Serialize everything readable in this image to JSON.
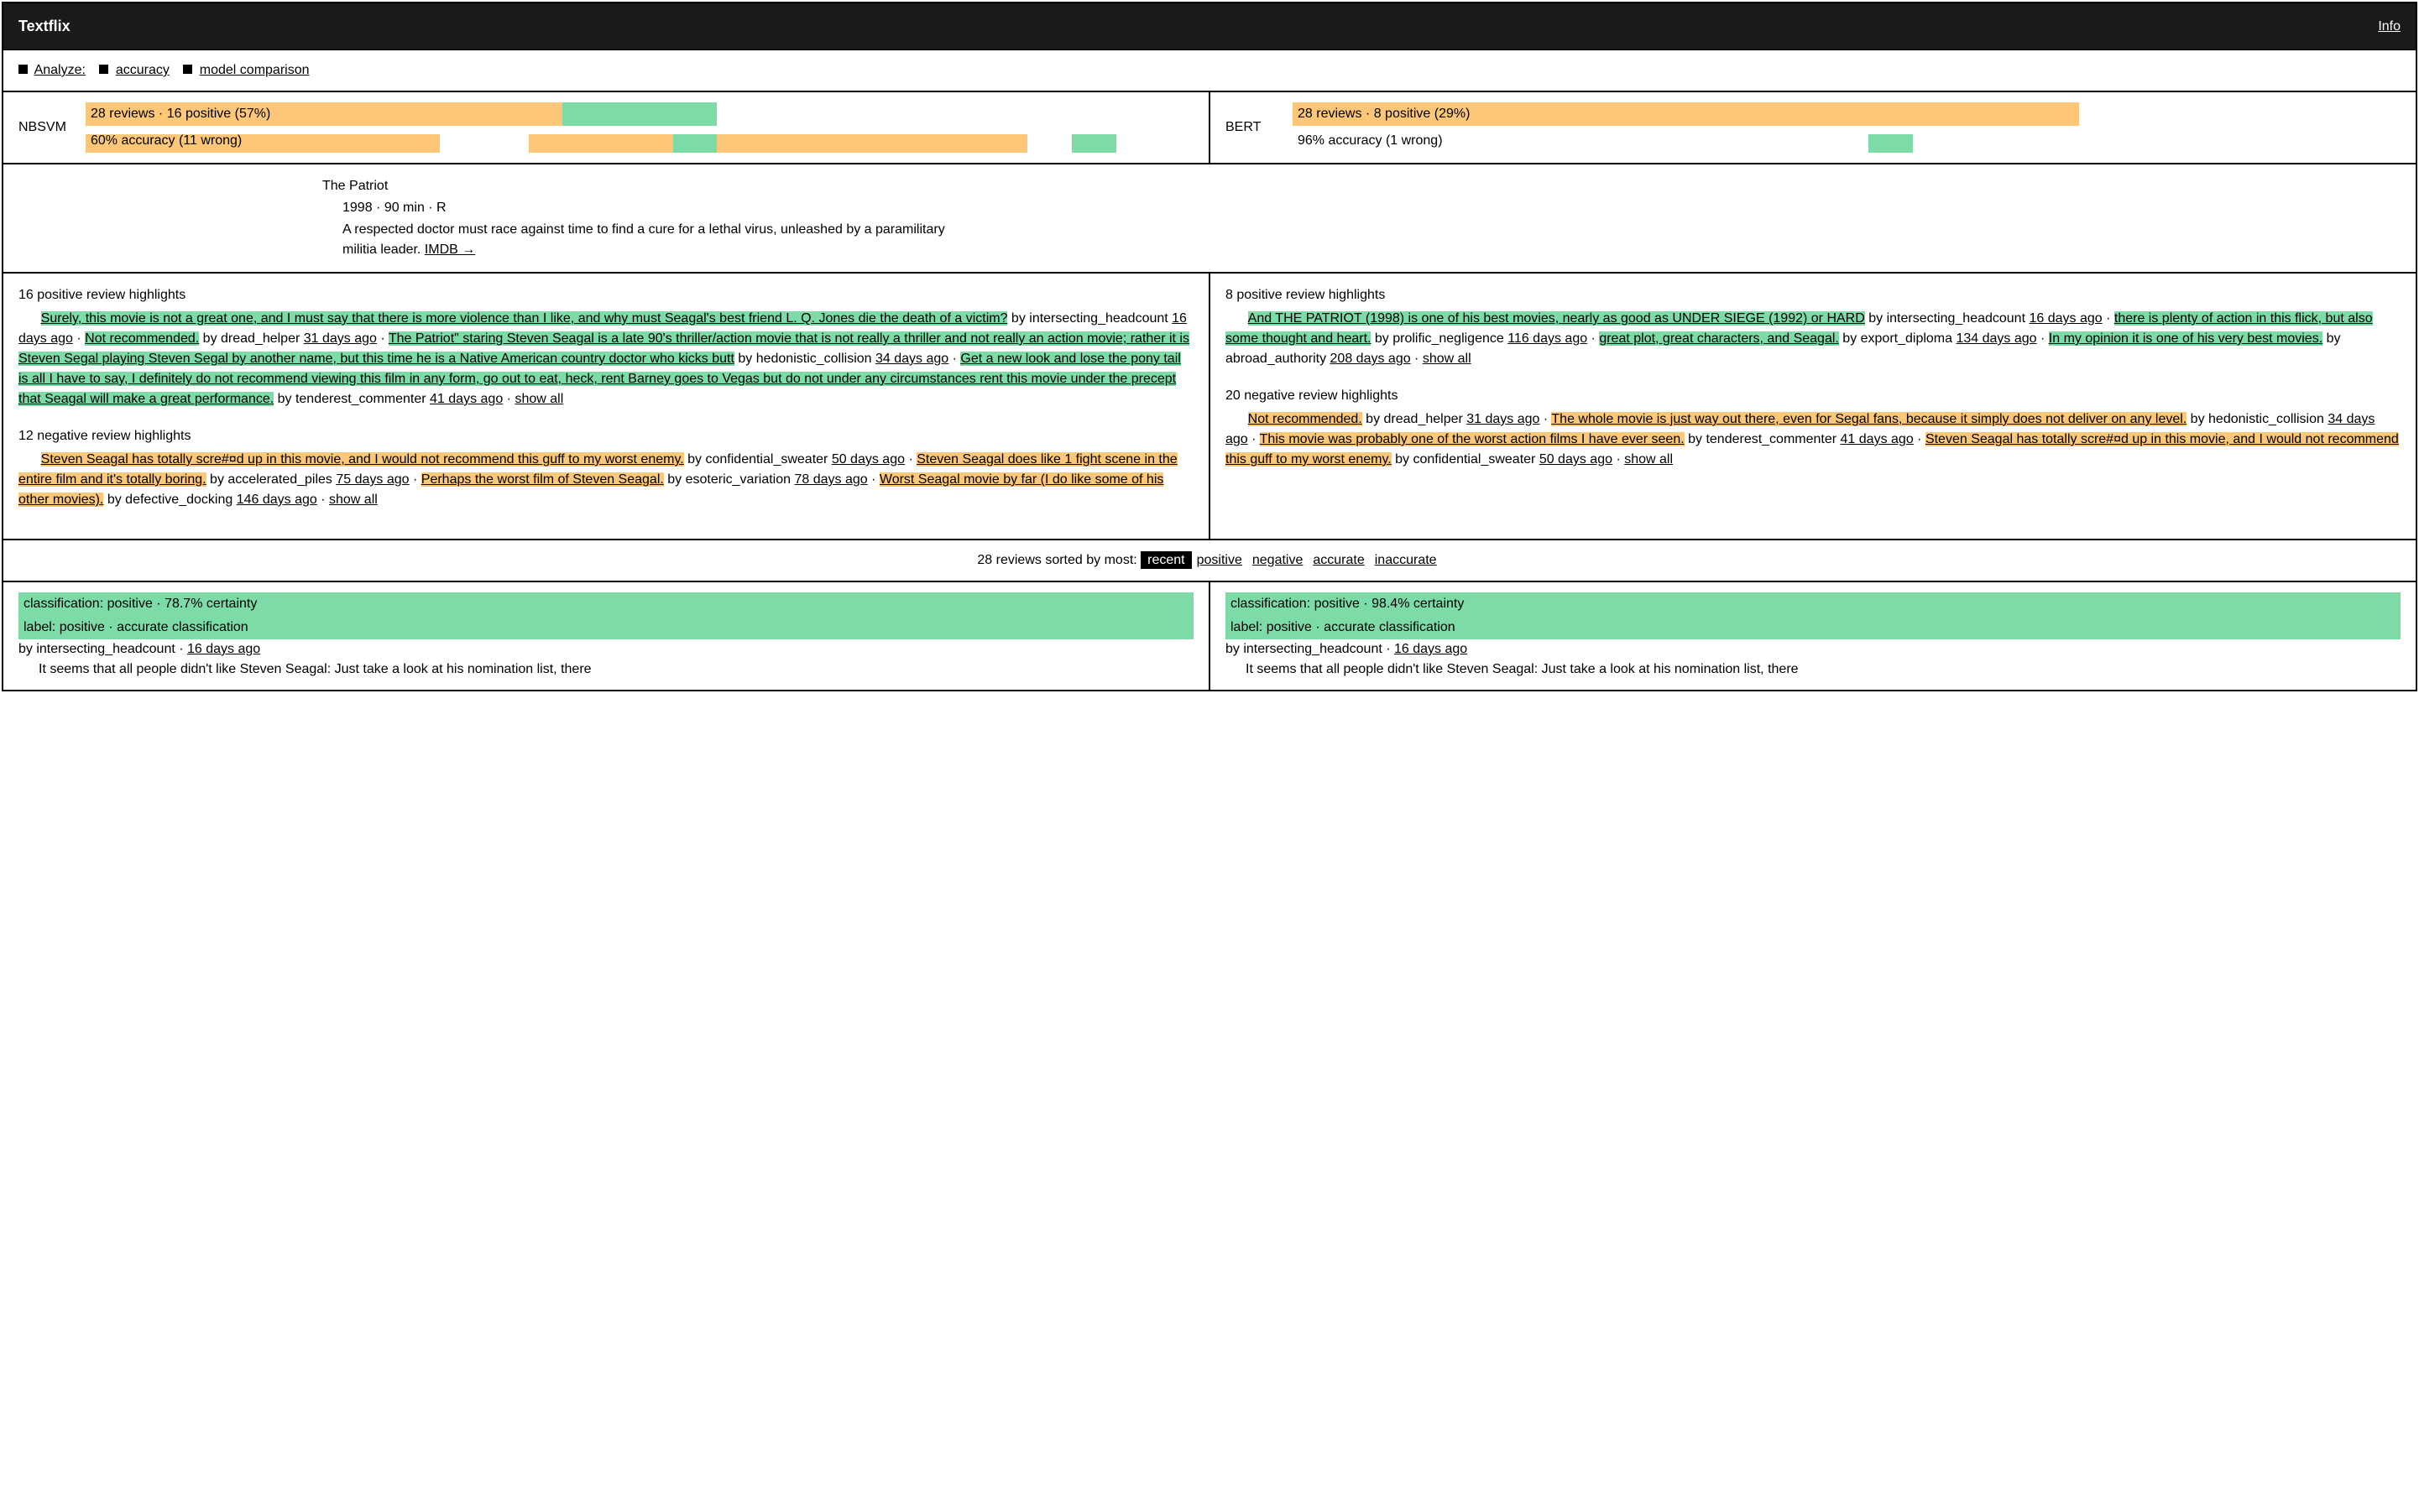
{
  "header": {
    "title": "Textflix",
    "info": "Info"
  },
  "breadcrumb": {
    "analyze": "Analyze:",
    "accuracy": "accuracy",
    "model_comparison": "model comparison"
  },
  "models": {
    "left": {
      "name": "NBSVM",
      "reviews_line": "28 reviews · 16 positive (57%)",
      "accuracy_line": "60% accuracy (11 wrong)",
      "pos_pct": 57,
      "segments": [
        {
          "c": "o",
          "w": 32
        },
        {
          "c": "w",
          "w": 8
        },
        {
          "c": "o",
          "w": 13
        },
        {
          "c": "g",
          "w": 4
        },
        {
          "c": "o",
          "w": 28
        },
        {
          "c": "w",
          "w": 4
        },
        {
          "c": "g",
          "w": 4
        },
        {
          "c": "w",
          "w": 7
        }
      ]
    },
    "right": {
      "name": "BERT",
      "reviews_line": "28 reviews · 8 positive (29%)",
      "accuracy_line": "96% accuracy (1 wrong)",
      "pos_pct": 29,
      "segments": [
        {
          "c": "w",
          "w": 52
        },
        {
          "c": "g",
          "w": 4
        },
        {
          "c": "w",
          "w": 44
        }
      ]
    }
  },
  "movie": {
    "title": "The Patriot",
    "meta": "1998 · 90 min · R",
    "synopsis_prefix": "A respected doctor must race against time to find a cure for a lethal virus, unleashed by a paramilitary militia leader. ",
    "imdb": "IMDB →"
  },
  "highlights": {
    "left": {
      "pos_heading": "16 positive review highlights",
      "pos_items": [
        {
          "text": "Surely, this movie is not a great one, and I must say that there is more violence than I like, and why must Seagal's best friend L. Q. Jones die the death of a victim?",
          "by": "intersecting_headcount",
          "age": "16 days ago"
        },
        {
          "text": "Not recommended.",
          "by": "dread_helper",
          "age": "31 days ago"
        },
        {
          "text": "The Patriot\" staring Steven Seagal is a late 90's thriller/action movie that is not really a thriller and not really an action movie; rather it is Steven Segal playing Steven Segal by another name, but this time he is a Native American country doctor who kicks butt",
          "by": "hedonistic_collision",
          "age": "34 days ago"
        },
        {
          "text": "Get a new look and lose the pony tail is all I have to say, I definitely do not recommend viewing this film in any form, go out to eat, heck, rent Barney goes to Vegas but do not under any circumstances rent this movie under the precept that Seagal will make a great performance.",
          "by": "tenderest_commenter",
          "age": "41 days ago"
        }
      ],
      "neg_heading": "12 negative review highlights",
      "neg_items": [
        {
          "text": "Steven Seagal has totally scre#¤d up in this movie, and I would not recommend this guff to my worst enemy.",
          "by": "confidential_sweater",
          "age": "50 days ago"
        },
        {
          "text": "Steven Seagal does like 1 fight scene in the entire film and it's totally boring.",
          "by": "accelerated_piles",
          "age": "75 days ago"
        },
        {
          "text": "Perhaps the worst film of Steven Seagal.",
          "by": "esoteric_variation",
          "age": "78 days ago"
        },
        {
          "text": "Worst Seagal movie by far (I do like some of his other movies).",
          "by": "defective_docking",
          "age": "146 days ago"
        }
      ],
      "show_all": "show all"
    },
    "right": {
      "pos_heading": "8 positive review highlights",
      "pos_items": [
        {
          "text": "And THE PATRIOT (1998) is one of his best movies, nearly as good as UNDER SIEGE (1992) or HARD",
          "by": "intersecting_headcount",
          "age": "16 days ago"
        },
        {
          "text": "there is plenty of action in this flick, but also some thought and heart.",
          "by": "prolific_negligence",
          "age": "116 days ago"
        },
        {
          "text": "great plot, great characters, and Seagal.",
          "by": "export_diploma",
          "age": "134 days ago"
        },
        {
          "text": "In my opinion it is one of his very best movies.",
          "by": "abroad_authority",
          "age": "208 days ago"
        }
      ],
      "neg_heading": "20 negative review highlights",
      "neg_items": [
        {
          "text": "Not recommended.",
          "by": "dread_helper",
          "age": "31 days ago"
        },
        {
          "text": "The whole movie is just way out there, even for Segal fans, because it simply does not deliver on any level.",
          "by": "hedonistic_collision",
          "age": "34 days ago"
        },
        {
          "text": "This movie was probably one of the worst action films I have ever seen.",
          "by": "tenderest_commenter",
          "age": "41 days ago"
        },
        {
          "text": "Steven Seagal has totally scre#¤d up in this movie, and I would not recommend this guff to my worst enemy.",
          "by": "confidential_sweater",
          "age": "50 days ago"
        }
      ],
      "show_all": "show all"
    }
  },
  "sort": {
    "label": "28 reviews sorted by most:",
    "options": [
      "recent",
      "positive",
      "negative",
      "accurate",
      "inaccurate"
    ],
    "active": "recent"
  },
  "review_cards": {
    "left": {
      "class_line": "classification: positive · 78.7% certainty",
      "label_line": "label: positive · accurate classification",
      "byline_prefix": "by intersecting_headcount · ",
      "byline_age": "16 days ago",
      "text": "It seems that all people didn't like Steven Seagal: Just take a look at his nomination list, there"
    },
    "right": {
      "class_line": "classification: positive · 98.4% certainty",
      "label_line": "label: positive · accurate classification",
      "byline_prefix": "by intersecting_headcount · ",
      "byline_age": "16 days ago",
      "text": "It seems that all people didn't like Steven Seagal: Just take a look at his nomination list, there"
    }
  }
}
